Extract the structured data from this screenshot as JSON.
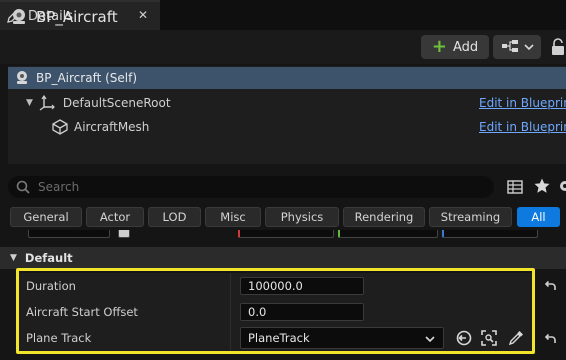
{
  "tab": {
    "title": "Details",
    "icon": "pencil-icon",
    "close_label": "✕"
  },
  "header": {
    "actor_name": "BP_Aircraft",
    "add_label": "Add",
    "add_icon": "plus-icon",
    "blueprint_icon": "blueprint-tree-icon"
  },
  "components": {
    "self": "BP_Aircraft (Self)",
    "items": [
      {
        "name": "DefaultSceneRoot",
        "link": "Edit in Blueprint"
      },
      {
        "name": "AircraftMesh",
        "link": "Edit in Blueprint"
      }
    ]
  },
  "search": {
    "placeholder": "Search"
  },
  "categories": [
    "General",
    "Actor",
    "LOD",
    "Misc",
    "Physics",
    "Rendering",
    "Streaming",
    "All"
  ],
  "active_category": "All",
  "section": {
    "title": "Default"
  },
  "properties": {
    "duration": {
      "label": "Duration",
      "value": "100000.0"
    },
    "start_offset": {
      "label": "Aircraft Start Offset",
      "value": "0.0"
    },
    "plane_track": {
      "label": "Plane Track",
      "value": "PlaneTrack"
    }
  },
  "colors": {
    "accent": "#0e7ae0",
    "highlight": "#f2e32b",
    "selection": "#3d536b",
    "link": "#6ea8ff",
    "add_plus": "#6ec23b"
  }
}
